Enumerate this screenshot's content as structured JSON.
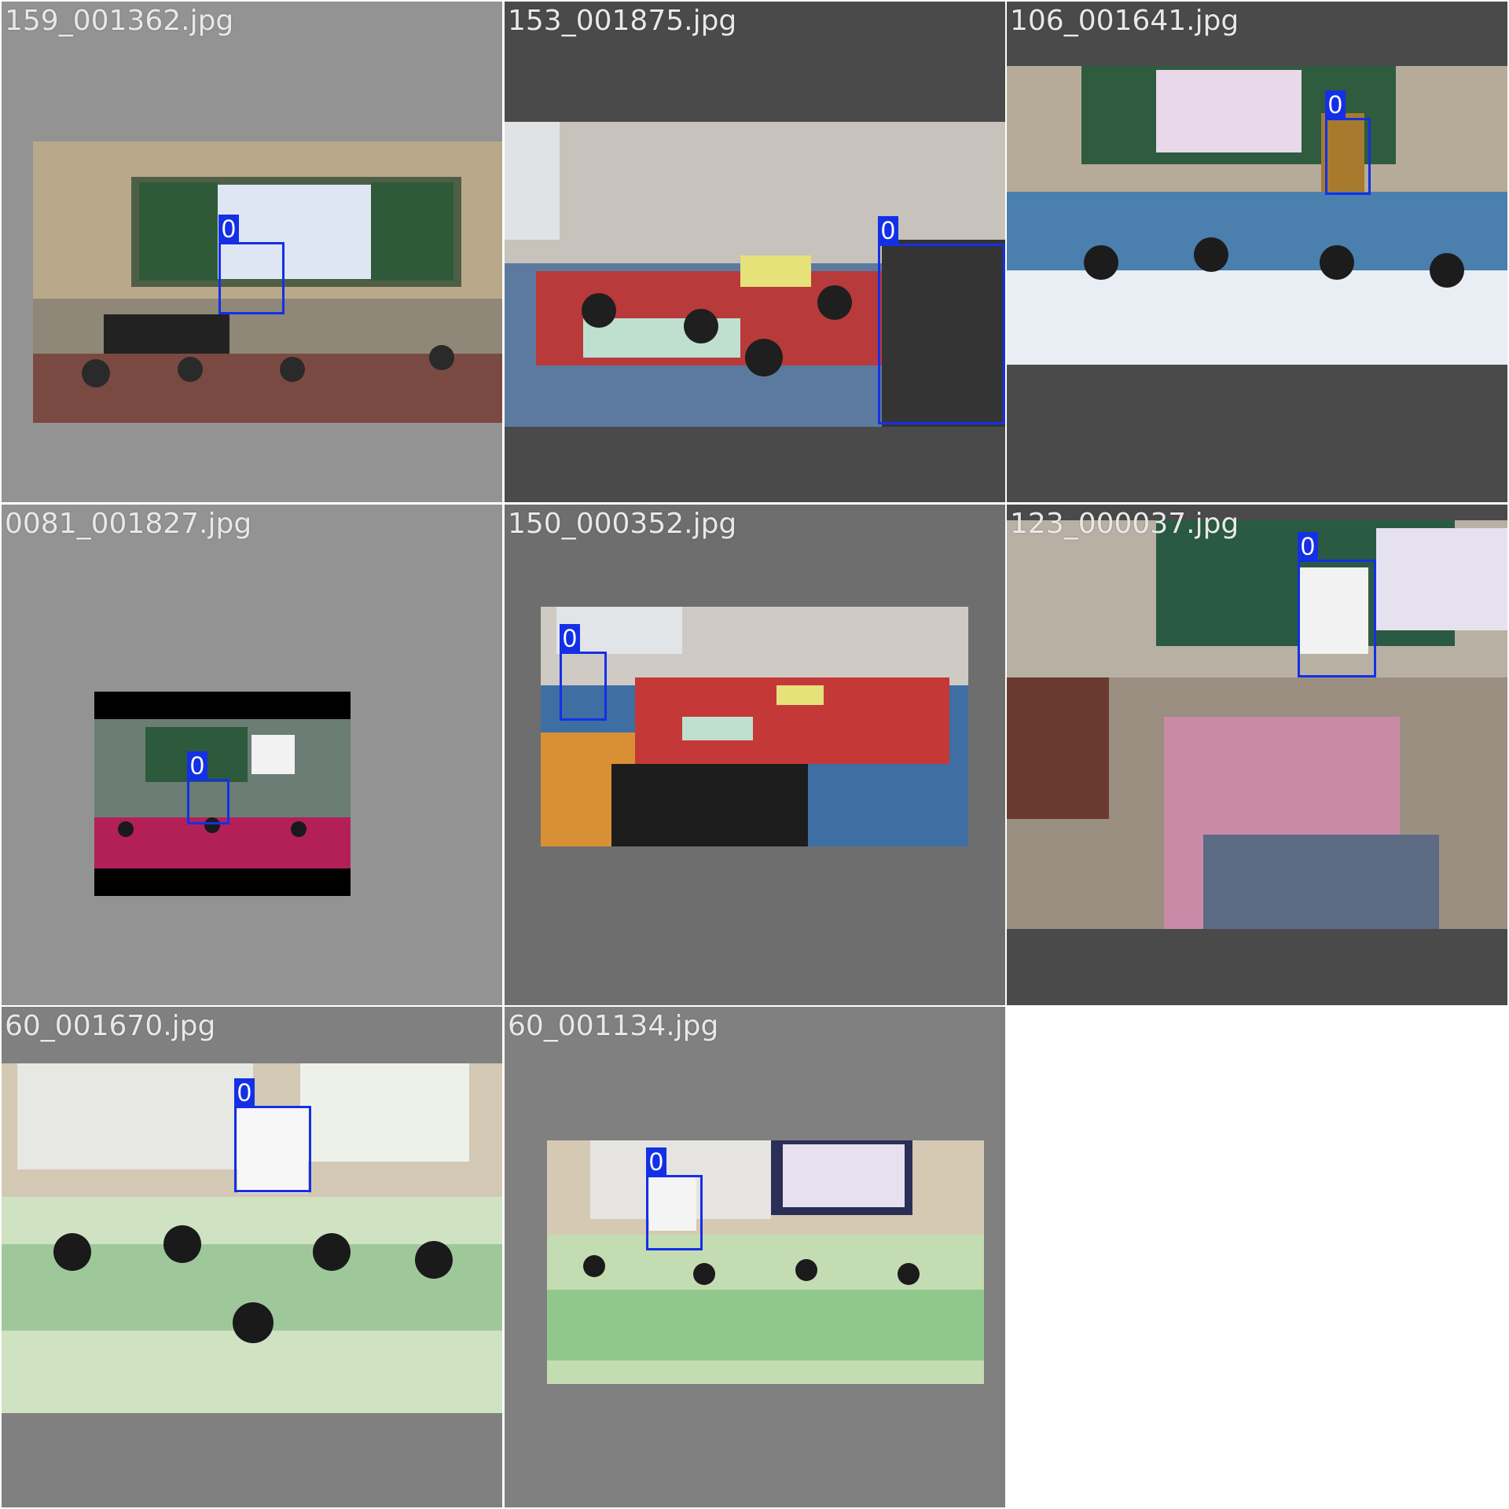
{
  "grid": {
    "tiles": [
      {
        "filename": "159_001362.jpg",
        "class_label": "0"
      },
      {
        "filename": "153_001875.jpg",
        "class_label": "0"
      },
      {
        "filename": "106_001641.jpg",
        "class_label": "0"
      },
      {
        "filename": "0081_001827.jpg",
        "class_label": "0"
      },
      {
        "filename": "150_000352.jpg",
        "class_label": "0"
      },
      {
        "filename": "123_000037.jpg",
        "class_label": "0"
      },
      {
        "filename": "60_001670.jpg",
        "class_label": "0"
      },
      {
        "filename": "60_001134.jpg",
        "class_label": "0"
      }
    ]
  },
  "colors": {
    "bbox": "#1430e6",
    "tile_bg_light": "#969696",
    "tile_bg_dark": "#4a4a4a"
  }
}
